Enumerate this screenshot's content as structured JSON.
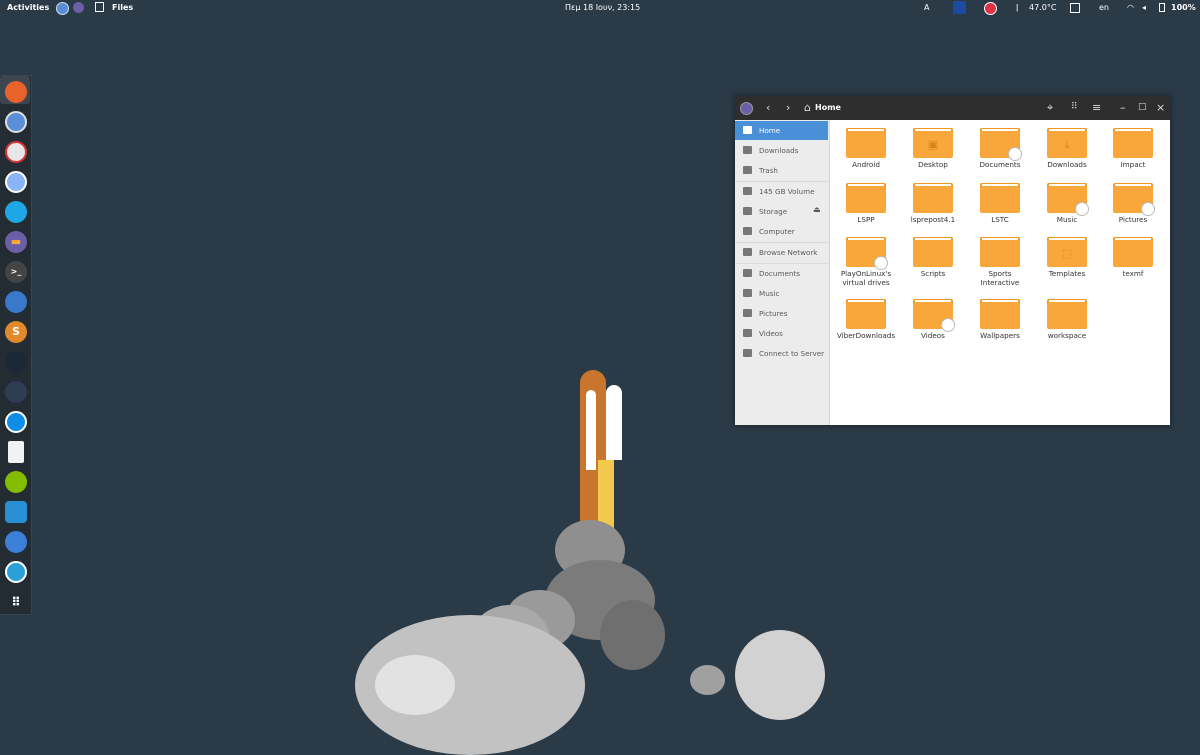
{
  "topbar": {
    "activities": "Activities",
    "app_name": "Files",
    "clock": "Πεμ 18 Ιουν, 23:15",
    "temperature": "47.0°C",
    "language": "en",
    "battery": "100%"
  },
  "dock": {
    "items": [
      "firefox-icon",
      "chromium-icon",
      "app-icon",
      "pidgin-icon",
      "skype-icon",
      "files-icon",
      "terminal-icon",
      "virtualbox-icon",
      "sublime-icon",
      "steam-icon",
      "kodi-icon",
      "teamviewer-icon",
      "document-icon",
      "spotify-icon",
      "image-viewer-icon",
      "settings-icon",
      "sync-icon",
      "app-grid-icon"
    ],
    "letters": [
      "",
      "",
      "",
      "",
      "",
      "",
      ">_",
      "",
      "S",
      "",
      "",
      "",
      "",
      "",
      "",
      "",
      "",
      ""
    ]
  },
  "window": {
    "path_label": "Home",
    "sidebar": [
      {
        "label": "Home",
        "icon": "home-icon"
      },
      {
        "label": "Downloads",
        "icon": "download-icon"
      },
      {
        "label": "Trash",
        "icon": "trash-icon"
      },
      {
        "label": "145 GB Volume",
        "icon": "drive-icon"
      },
      {
        "label": "Storage",
        "icon": "drive-icon"
      },
      {
        "label": "Computer",
        "icon": "computer-icon"
      },
      {
        "label": "Browse Network",
        "icon": "network-icon"
      },
      {
        "label": "Documents",
        "icon": "folder-icon"
      },
      {
        "label": "Music",
        "icon": "folder-icon"
      },
      {
        "label": "Pictures",
        "icon": "folder-icon"
      },
      {
        "label": "Videos",
        "icon": "folder-icon"
      },
      {
        "label": "Connect to Server",
        "icon": "server-icon"
      }
    ],
    "folders": [
      {
        "name": "Android",
        "emblem": "",
        "link": false
      },
      {
        "name": "Desktop",
        "emblem": "▣",
        "link": false
      },
      {
        "name": "Documents",
        "emblem": "",
        "link": true
      },
      {
        "name": "Downloads",
        "emblem": "⤓",
        "link": false
      },
      {
        "name": "Impact",
        "emblem": "",
        "link": false
      },
      {
        "name": "LSPP",
        "emblem": "",
        "link": false
      },
      {
        "name": "lsprepost4.1",
        "emblem": "",
        "link": false
      },
      {
        "name": "LSTC",
        "emblem": "",
        "link": false
      },
      {
        "name": "Music",
        "emblem": "",
        "link": true
      },
      {
        "name": "Pictures",
        "emblem": "",
        "link": true
      },
      {
        "name": "PlayOnLinux's virtual drives",
        "emblem": "",
        "link": true
      },
      {
        "name": "Scripts",
        "emblem": "",
        "link": false
      },
      {
        "name": "Sports Interactive",
        "emblem": "",
        "link": false
      },
      {
        "name": "Templates",
        "emblem": "⬚",
        "link": false
      },
      {
        "name": "texmf",
        "emblem": "",
        "link": false
      },
      {
        "name": "ViberDownloads",
        "emblem": "",
        "link": false
      },
      {
        "name": "Videos",
        "emblem": "",
        "link": true
      },
      {
        "name": "Wallpapers",
        "emblem": "",
        "link": false
      },
      {
        "name": "workspace",
        "emblem": "",
        "link": false
      }
    ]
  },
  "colors": {
    "desktop_bg": "#2b3a47",
    "accent": "#4a90d9",
    "folder": "#f9a73a"
  }
}
